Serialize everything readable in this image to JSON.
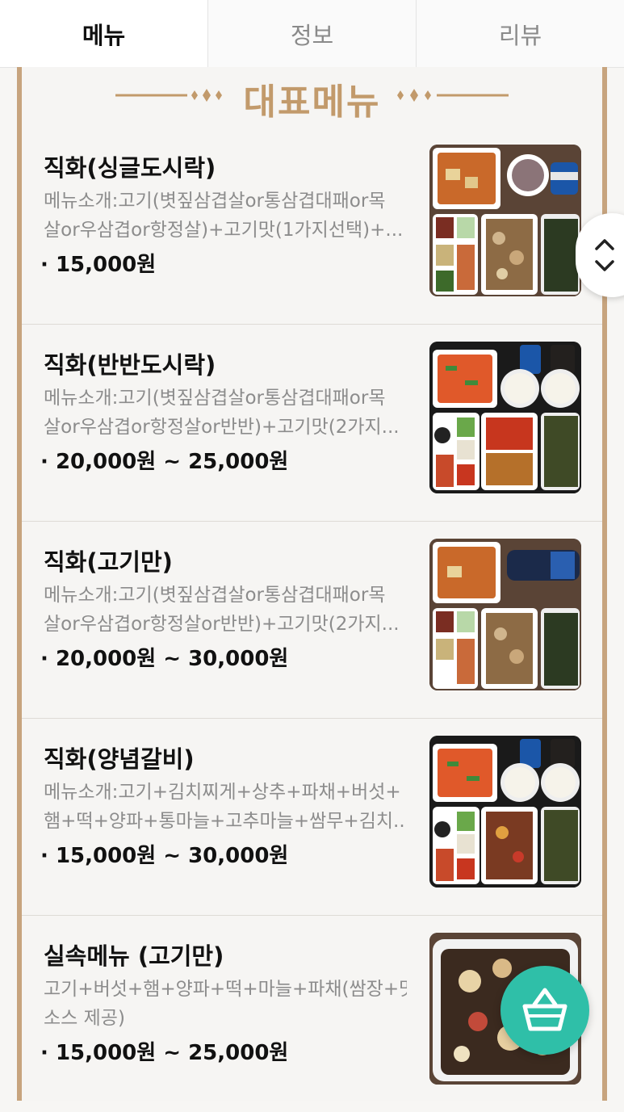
{
  "tabs": [
    "메뉴",
    "정보",
    "리뷰"
  ],
  "section_title": "대표메뉴",
  "items": [
    {
      "name": "직화(싱글도시락)",
      "desc1": "메뉴소개:고기(볏짚삼겹살or통삼겹대패or목",
      "desc2": "살or우삼겹or항정살)+고기맛(1가지선택)+...",
      "price": "15,000원"
    },
    {
      "name": "직화(반반도시락)",
      "desc1": "메뉴소개:고기(볏짚삼겹살or통삼겹대패or목",
      "desc2": "살or우삼겹or항정살or반반)+고기맛(2가지...",
      "price": "20,000원 ~ 25,000원"
    },
    {
      "name": "직화(고기만)",
      "desc1": "메뉴소개:고기(볏짚삼겹살or통삼겹대패or목",
      "desc2": "살or우삼겹or항정살or반반)+고기맛(2가지...",
      "price": "20,000원 ~ 30,000원"
    },
    {
      "name": "직화(양념갈비)",
      "desc1": "메뉴소개:고기+김치찌게+상추+파채+버섯+",
      "desc2": "햄+떡+양파+통마늘+고추마늘+쌈무+김치...",
      "price": "15,000원 ~ 30,000원"
    },
    {
      "name": "실속메뉴 (고기만)",
      "desc1": "고기+버섯+햄+양파+떡+마늘+파채(쌈장+맛",
      "desc2": "소스 제공)",
      "price": "15,000원 ~ 25,000원"
    }
  ],
  "icons": {
    "scroll": "chevron-up-down-icon",
    "cart": "basket-icon"
  },
  "colors": {
    "accent_gold": "#c29a6b",
    "frame_border": "#c7a47e",
    "cart_teal": "#2fbfa8"
  }
}
